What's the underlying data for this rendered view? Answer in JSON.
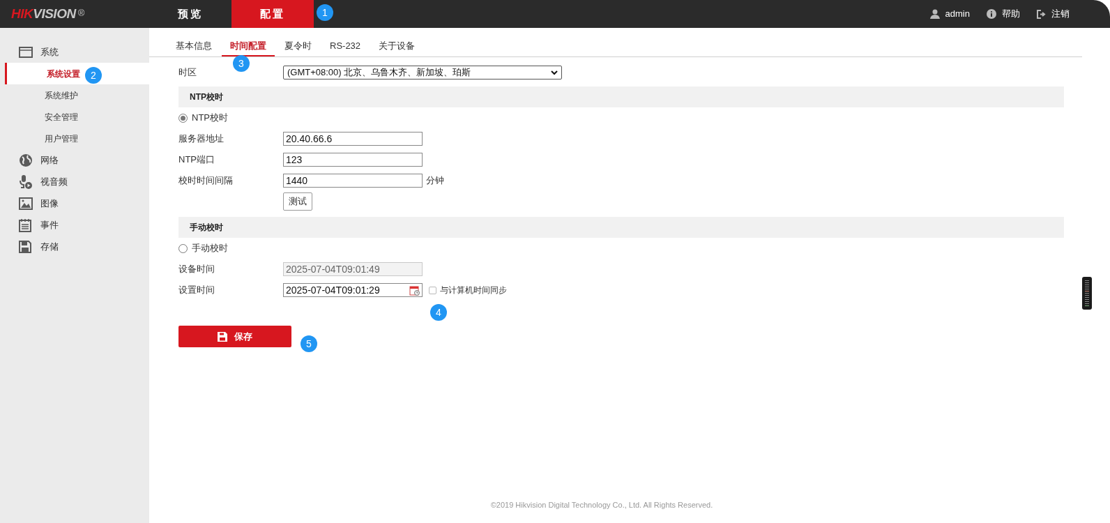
{
  "header": {
    "logo": [
      {
        "text": "HIK",
        "color": "#d7171f"
      },
      {
        "text": "VISION",
        "color": "#c8c8c8"
      }
    ],
    "logo_mark": "®",
    "nav": [
      {
        "label": "预览",
        "selected": false
      },
      {
        "label": "配置",
        "selected": true
      }
    ],
    "user": "admin",
    "help": "帮助",
    "logout": "注销"
  },
  "sidebar": {
    "items": [
      {
        "label": "系统",
        "kind": "window",
        "children": [
          {
            "label": "系统设置",
            "selected": true
          },
          {
            "label": "系统维护",
            "selected": false
          },
          {
            "label": "安全管理",
            "selected": false
          },
          {
            "label": "用户管理",
            "selected": false
          }
        ]
      },
      {
        "label": "网络",
        "kind": "globe"
      },
      {
        "label": "视音频",
        "kind": "mic"
      },
      {
        "label": "图像",
        "kind": "image"
      },
      {
        "label": "事件",
        "kind": "notepad"
      },
      {
        "label": "存储",
        "kind": "disk"
      }
    ]
  },
  "tabs": [
    {
      "label": "基本信息",
      "selected": false
    },
    {
      "label": "时间配置",
      "selected": true
    },
    {
      "label": "夏令时",
      "selected": false
    },
    {
      "label": "RS-232",
      "selected": false
    },
    {
      "label": "关于设备",
      "selected": false
    }
  ],
  "timezone": {
    "label": "时区",
    "value": "(GMT+08:00) 北京、乌鲁木齐、新加坡、珀斯"
  },
  "ntp": {
    "title": "NTP校时",
    "radio": {
      "label": "NTP校时",
      "selected": true
    },
    "server": {
      "label": "服务器地址",
      "value": "20.40.66.6"
    },
    "port": {
      "label": "NTP端口",
      "value": "123"
    },
    "interval": {
      "label": "校时时间间隔",
      "value": "1440",
      "unit": "分钟"
    },
    "test_button": "测试"
  },
  "manual": {
    "title": "手动校时",
    "radio": {
      "label": "手动校时",
      "selected": false
    },
    "device_time": {
      "label": "设备时间",
      "value": "2025-07-04T09:01:49",
      "disabled": true
    },
    "set_time": {
      "label": "设置时间",
      "value": "2025-07-04T09:01:29",
      "disabled": false
    },
    "sync": {
      "label": "与计算机时间同步",
      "checked": false
    }
  },
  "save_button": "保存",
  "footer": "©2019 Hikvision Digital Technology Co., Ltd. All Rights Reserved.",
  "markers": [
    {
      "label": "1"
    },
    {
      "label": "2"
    },
    {
      "label": "3"
    },
    {
      "label": "4"
    },
    {
      "label": "5"
    }
  ]
}
